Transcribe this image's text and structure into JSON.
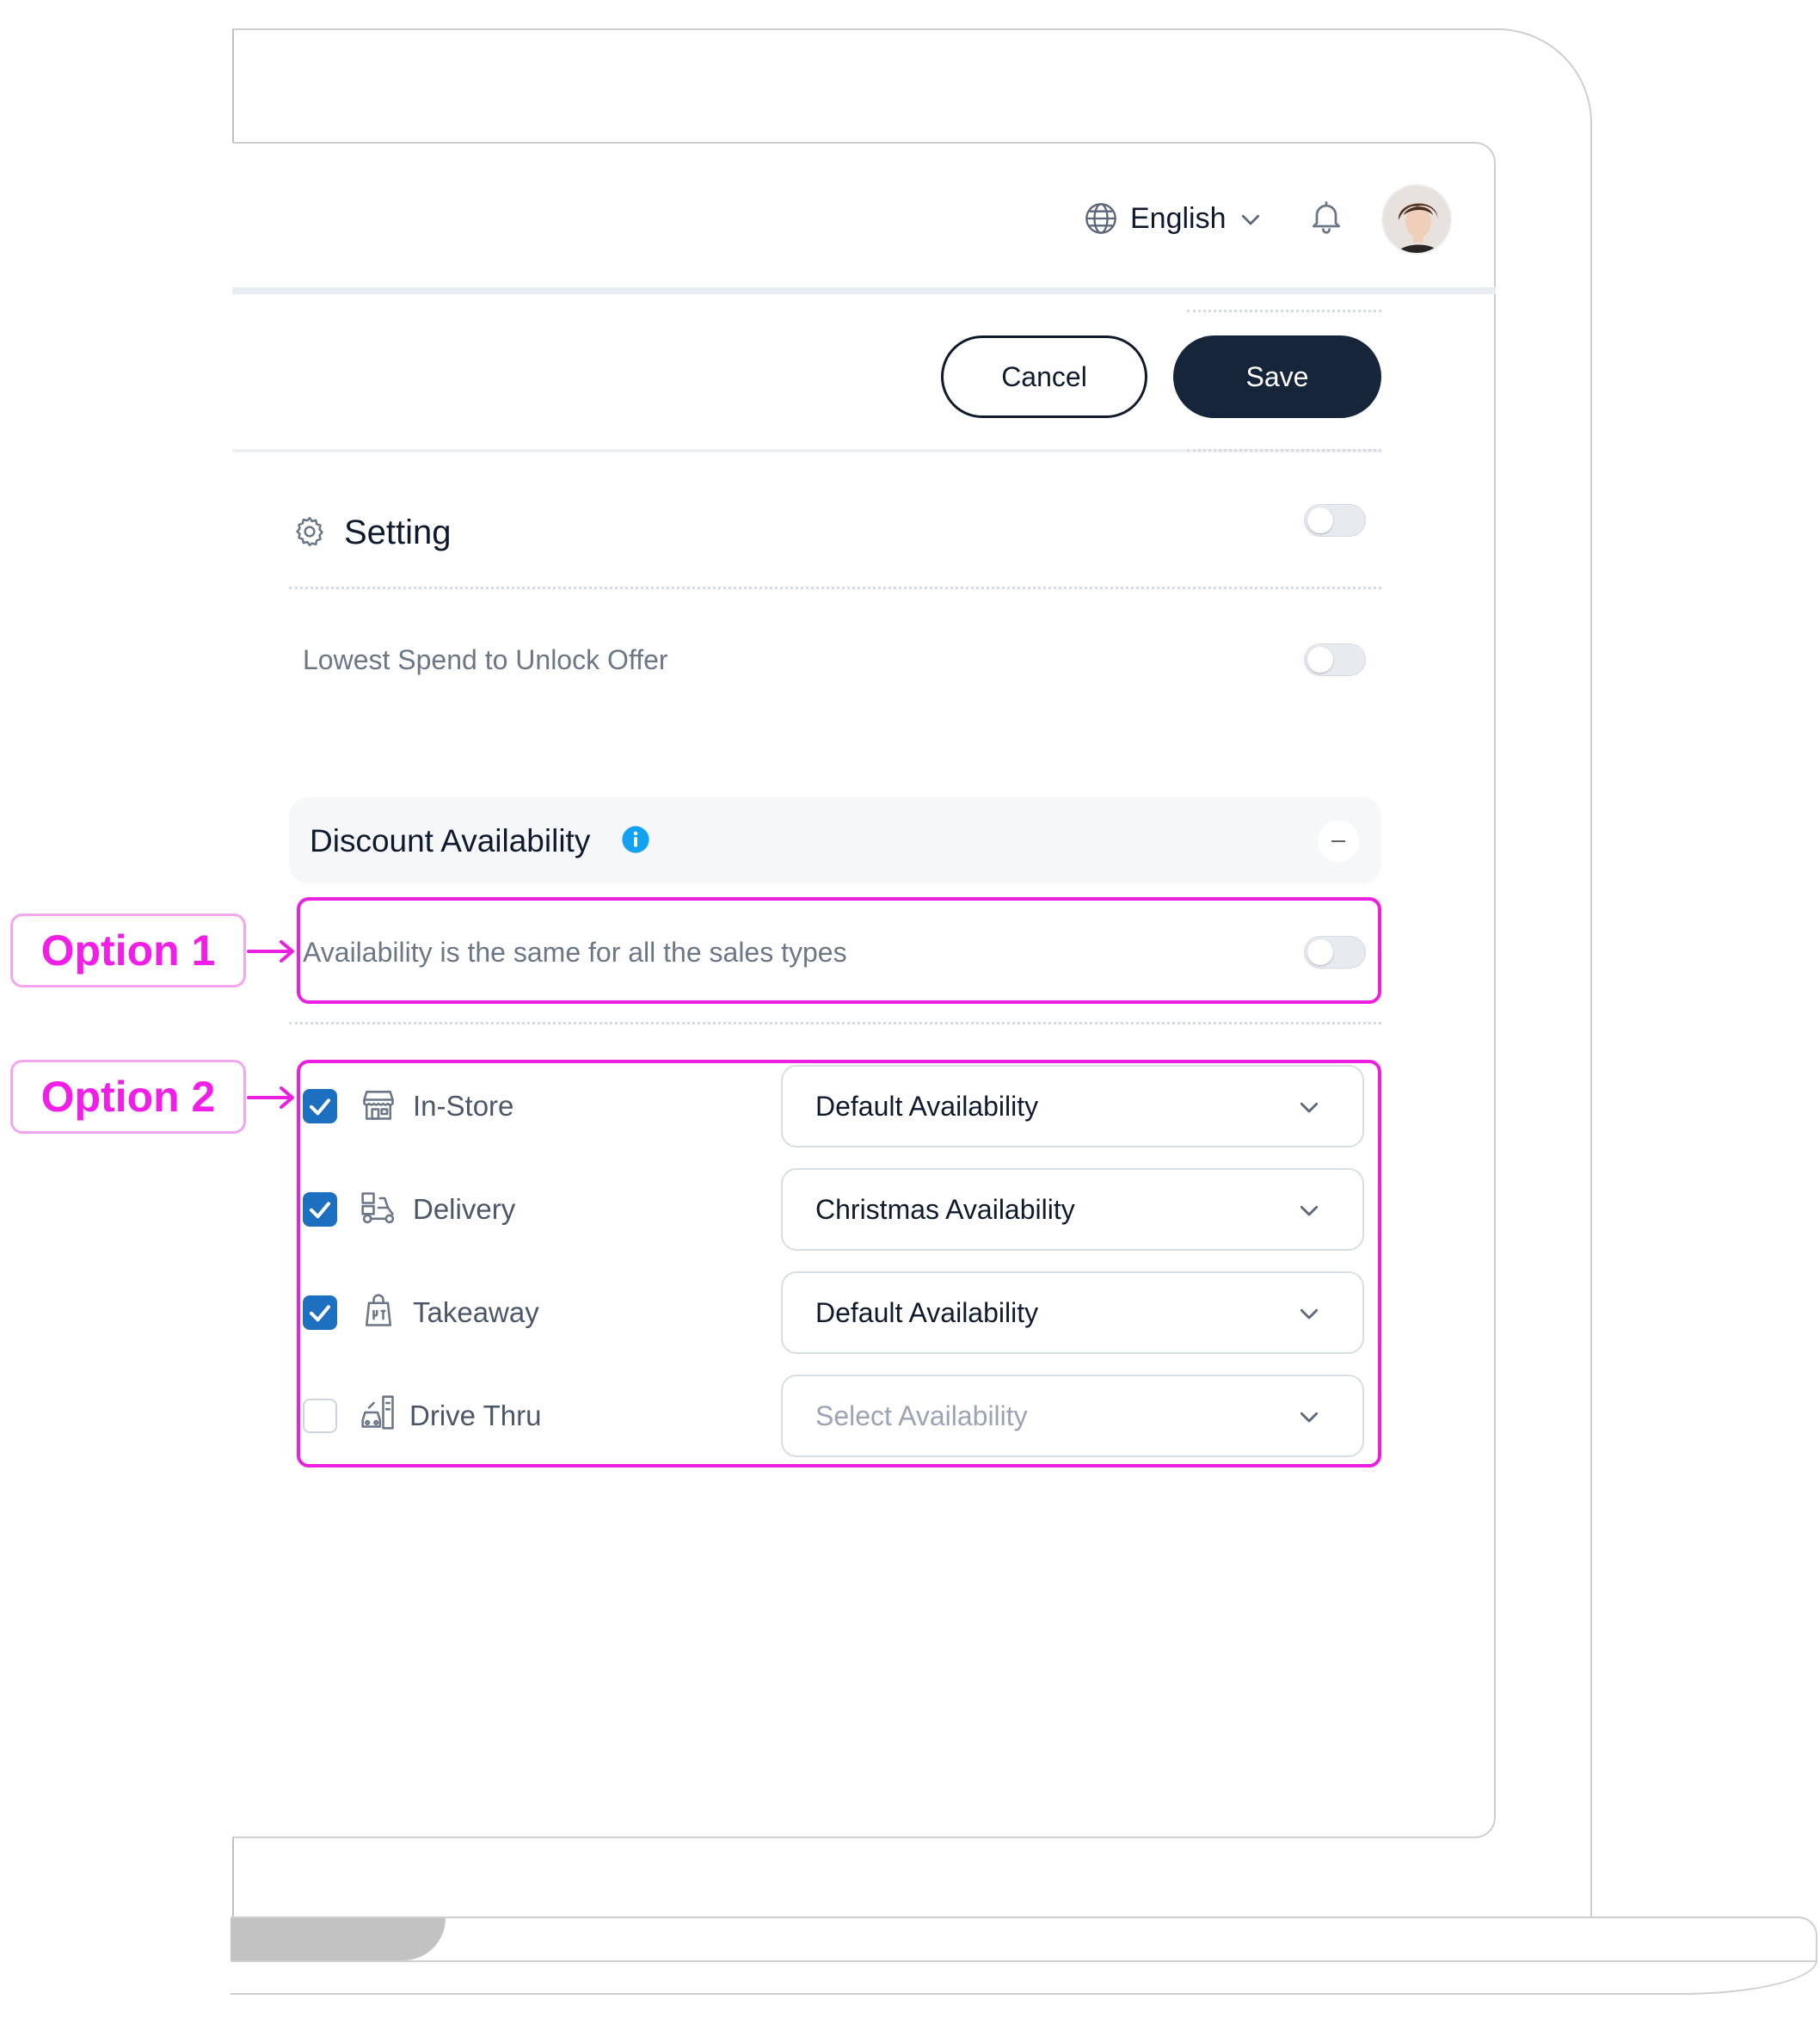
{
  "header": {
    "language": "English",
    "globe_icon": "globe-icon",
    "bell_icon": "bell-icon"
  },
  "actions": {
    "cancel_label": "Cancel",
    "save_label": "Save"
  },
  "setting": {
    "title": "Setting",
    "icon": "gear-icon",
    "toggle_on": false
  },
  "lowest_spend": {
    "label": "Lowest Spend to Unlock Offer",
    "toggle_on": false
  },
  "discount_availability": {
    "title": "Discount Availability",
    "same_for_all_label": "Availability is the same for all the sales types",
    "same_for_all_on": false,
    "rows": [
      {
        "label": "In-Store",
        "icon": "store-icon",
        "checked": true,
        "value": "Default Availability"
      },
      {
        "label": "Delivery",
        "icon": "delivery-icon",
        "checked": true,
        "value": "Christmas Availability"
      },
      {
        "label": "Takeaway",
        "icon": "takeaway-bag-icon",
        "checked": true,
        "value": "Default Availability"
      },
      {
        "label": "Drive Thru",
        "icon": "drive-thru-icon",
        "checked": false,
        "value": "Select Availability"
      }
    ]
  },
  "annotations": {
    "option1": "Option 1",
    "option2": "Option 2"
  },
  "colors": {
    "accent": "#1d6fbf",
    "save_button": "#17253a",
    "annotation": "#ea1fe0",
    "info": "#13a2f2"
  }
}
